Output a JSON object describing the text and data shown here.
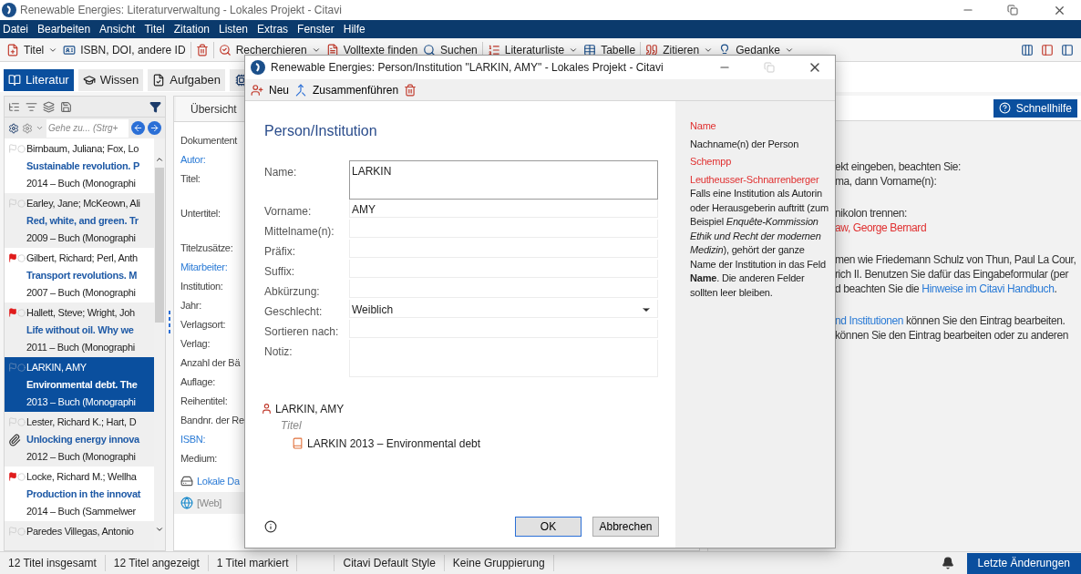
{
  "window": {
    "title": "Renewable Energies: Literaturverwaltung - Lokales Projekt - Citavi"
  },
  "menu": [
    "Datei",
    "Bearbeiten",
    "Ansicht",
    "Titel",
    "Zitation",
    "Listen",
    "Extras",
    "Fenster",
    "Hilfe"
  ],
  "toolbar": [
    {
      "label": "Titel",
      "dropdown": true
    },
    {
      "label": "ISBN, DOI, andere ID",
      "dropdown": false
    },
    {
      "dropdown": false
    },
    {
      "label": "Recherchieren",
      "dropdown": true
    },
    {
      "label": "Volltexte finden",
      "dropdown": false
    },
    {
      "label": "Suchen",
      "dropdown": false
    },
    {
      "label": "Literaturliste",
      "dropdown": true
    },
    {
      "label": "Tabelle",
      "dropdown": false
    },
    {
      "label": "Zitieren",
      "dropdown": true
    },
    {
      "label": "Gedanke",
      "dropdown": true
    }
  ],
  "nav_tabs": [
    {
      "label": "Literatur",
      "selected": true
    },
    {
      "label": "Wissen",
      "selected": false
    },
    {
      "label": "Aufgaben",
      "selected": false
    }
  ],
  "reference_list": {
    "search": {
      "placeholder": "Gehe zu... (Strg+"
    },
    "items": [
      {
        "authors": "Birnbaum, Juliana; Fox, Lo",
        "title": "Sustainable revolution. P",
        "meta": "2014 – Buch (Monographi",
        "flagged": false,
        "attachment": false,
        "selected": false
      },
      {
        "authors": "Earley, Jane; McKeown, Ali",
        "title": "Red, white, and green. Tr",
        "meta": "2009 – Buch (Monographi",
        "flagged": false,
        "attachment": false,
        "selected": false
      },
      {
        "authors": "Gilbert, Richard; Perl, Anth",
        "title": "Transport revolutions. M",
        "meta": "2007 – Buch (Monographi",
        "flagged": true,
        "attachment": false,
        "selected": false
      },
      {
        "authors": "Hallett, Steve; Wright, Joh",
        "title": "Life without oil. Why we",
        "meta": "2011 – Buch (Monographi",
        "flagged": true,
        "attachment": false,
        "selected": false
      },
      {
        "authors": "LARKIN, AMY",
        "title": "Environmental debt. The",
        "meta": "2013 – Buch (Monographi",
        "flagged": false,
        "attachment": false,
        "selected": true
      },
      {
        "authors": "Lester, Richard K.; Hart, D",
        "title": "Unlocking energy innova",
        "meta": "2012 – Buch (Monographi",
        "flagged": false,
        "attachment": true,
        "selected": false
      },
      {
        "authors": "Locke, Richard M.; Wellha",
        "title": "Production in the innovat",
        "meta": "2014 – Buch (Sammelwer",
        "flagged": true,
        "attachment": false,
        "selected": false
      },
      {
        "authors": "Paredes Villegas, Antonio",
        "flagged": false,
        "attachment": false,
        "selected": false
      }
    ]
  },
  "editor": {
    "tab": "Übersicht",
    "fields": [
      {
        "label": "Dokumentent",
        "kind": "plain"
      },
      {
        "label": "Autor:",
        "kind": "link"
      },
      {
        "label": "Titel:",
        "kind": "tall"
      },
      {
        "label": "Untertitel:",
        "kind": "tall"
      },
      {
        "label": "Titelzusätze:",
        "kind": "plain"
      },
      {
        "label": "Mitarbeiter:",
        "kind": "link"
      },
      {
        "label": "Institution:",
        "kind": "plain"
      },
      {
        "label": "Jahr:",
        "kind": "plain"
      },
      {
        "label": "Verlagsort:",
        "kind": "plain"
      },
      {
        "label": "Verlag:",
        "kind": "plain"
      },
      {
        "label": "Anzahl der Bä",
        "kind": "plain"
      },
      {
        "label": "Auflage:",
        "kind": "plain"
      },
      {
        "label": "Reihentitel:",
        "kind": "plain"
      },
      {
        "label": "Bandnr. der Re",
        "kind": "plain"
      },
      {
        "label": "ISBN:",
        "kind": "link"
      },
      {
        "label": "Medium:",
        "kind": "plain"
      }
    ],
    "locations": [
      {
        "label": "Lokale Da",
        "kind": "local"
      },
      {
        "label": "[Web]",
        "kind": "web"
      }
    ]
  },
  "help_panel": {
    "button": "Schnellhilfe",
    "paragraphs": [
      [
        {
          "parts": [
            {
              "text": "ekt eingeben, beachten Sie:",
              "kind": "plain"
            }
          ]
        },
        {
          "parts": [
            {
              "text": "ma, dann Vorname(n):",
              "kind": "plain"
            }
          ]
        }
      ],
      [
        {
          "parts": [
            {
              "text": "nikolon trennen:",
              "kind": "plain"
            }
          ]
        },
        {
          "parts": [
            {
              "text": "aw, George Bernard",
              "kind": "example"
            }
          ]
        }
      ],
      [
        {
          "parts": [
            {
              "text": "men wie Friedemann Schulz von Thun, Paul La Cour,",
              "kind": "plain"
            }
          ]
        },
        {
          "parts": [
            {
              "text": "rich II. Benutzen Sie dafür das Eingabeformular (per",
              "kind": "plain"
            }
          ]
        },
        {
          "parts": [
            {
              "text": "d beachten Sie die ",
              "kind": "plain"
            },
            {
              "text": "Hinweise im Citavi Handbuch",
              "kind": "link"
            },
            {
              "text": ".",
              "kind": "plain"
            }
          ]
        }
      ],
      [
        {
          "parts": [
            {
              "text": "nd Institutionen",
              "kind": "link"
            },
            {
              "text": " können Sie den Eintrag bearbeiten.",
              "kind": "plain"
            }
          ]
        },
        {
          "parts": [
            {
              "text": "können Sie den Eintrag bearbeiten oder zu anderen",
              "kind": "plain"
            }
          ]
        }
      ]
    ]
  },
  "dialog": {
    "title": "Renewable Energies: Person/Institution \"LARKIN, AMY\" - Lokales Projekt - Citavi",
    "toolbar": [
      "Neu",
      "Zusammenführen"
    ],
    "heading": "Person/Institution",
    "fields": [
      {
        "label": "Name:",
        "value": "LARKIN",
        "kind": "multiline",
        "focused": true
      },
      {
        "label": "Vorname:",
        "value": "AMY",
        "kind": "text",
        "focused": false
      },
      {
        "label": "Mittelname(n):",
        "kind": "text",
        "focused": false
      },
      {
        "label": "Präfix:",
        "kind": "text",
        "focused": false
      },
      {
        "label": "Suffix:",
        "kind": "text",
        "focused": false
      },
      {
        "label": "Abkürzung:",
        "kind": "text",
        "focused": false
      },
      {
        "label": "Geschlecht:",
        "value": "Weiblich",
        "kind": "select",
        "focused": false
      },
      {
        "label": "Sortieren nach:",
        "kind": "text",
        "focused": false
      },
      {
        "label": "Notiz:",
        "kind": "multiline",
        "focused": false
      }
    ],
    "usage": {
      "person": "LARKIN, AMY",
      "group": "Titel",
      "items": [
        "LARKIN 2013 – Environmental debt"
      ]
    },
    "hint": {
      "items": [
        {
          "text": "Name",
          "kind": "term"
        },
        {
          "text": "Nachname(n) der Person",
          "kind": "plain"
        },
        {
          "text": "Schempp",
          "kind": "example"
        },
        {
          "text": "Leutheusser-Schnarrenberger",
          "kind": "example"
        },
        {
          "text": "Falls eine Institution als Autorin oder Herausgeberin auftritt (zum Beispiel *Enquête-Kommission Ethik und Recht der modernen Medizin*), gehört der ganze Name der Institution in das Feld **Name**. Die anderen Felder sollten leer bleiben.",
          "kind": "plain"
        }
      ]
    },
    "buttons": [
      {
        "label": "OK",
        "default": true
      },
      {
        "label": "Abbrechen",
        "default": false
      }
    ]
  },
  "status_bar": {
    "items": [
      "12 Titel insgesamt",
      "12 Titel angezeigt",
      "1 Titel markiert",
      "Citavi Default Style",
      "Keine Gruppierung"
    ],
    "button": "Letzte Änderungen"
  }
}
